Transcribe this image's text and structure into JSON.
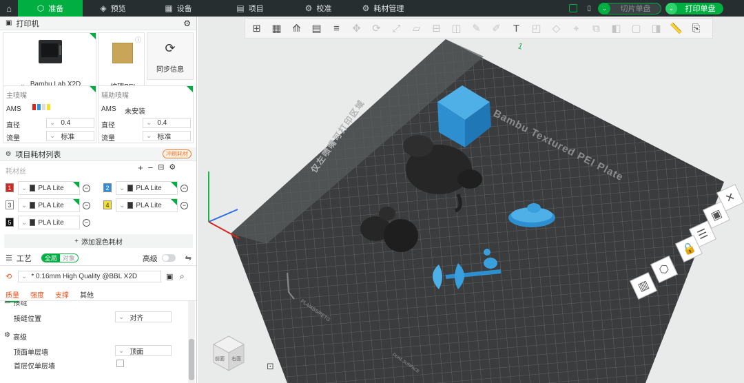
{
  "topbar": {
    "tabs": [
      {
        "label": "准备",
        "icon": "prepare-icon",
        "active": true
      },
      {
        "label": "预览",
        "icon": "preview-icon"
      },
      {
        "label": "设备",
        "icon": "device-icon"
      },
      {
        "label": "项目",
        "icon": "project-icon"
      },
      {
        "label": "校准",
        "icon": "calibrate-icon"
      },
      {
        "label": "耗材管理",
        "icon": "filament-manage-icon"
      }
    ],
    "slice_label": "切片单盘",
    "print_label": "打印单盘",
    "accent": "#00ae42"
  },
  "printer": {
    "section_title": "打印机",
    "model": "Bambu Lab X2D",
    "plate": "纹理PEI...",
    "sync_label": "同步信息",
    "main_nozzle": {
      "title": "主喷嘴",
      "ams": "AMS",
      "diameter_label": "直径",
      "diameter": "0.4",
      "flow_label": "流量",
      "flow": "标准"
    },
    "aux_nozzle": {
      "title": "辅助喷嘴",
      "ams": "AMS",
      "ams_state": "未安装",
      "diameter_label": "直径",
      "diameter": "0.4",
      "flow_label": "流量",
      "flow": "标准"
    }
  },
  "filament": {
    "section_title": "项目耗材列表",
    "badge": "冲刷耗材",
    "list_label": "耗材丝",
    "slots": [
      {
        "num": "1",
        "name": "PLA Lite",
        "color": "#d9251d",
        "text_color": "#ffffff"
      },
      {
        "num": "2",
        "name": "PLA Lite",
        "color": "#2f8fd8",
        "text_color": "#ffffff"
      },
      {
        "num": "3",
        "name": "PLA Lite",
        "color": "#ffffff",
        "text_color": "#333333"
      },
      {
        "num": "4",
        "name": "PLA Lite",
        "color": "#f5e02e",
        "text_color": "#333333"
      },
      {
        "num": "5",
        "name": "PLA Lite",
        "color": "#111111",
        "text_color": "#ffffff"
      }
    ],
    "add_mix_label": "添加混色耗材"
  },
  "process": {
    "section_title": "工艺",
    "toggle_global": "全局",
    "toggle_object": "对象",
    "advanced_label": "高级",
    "preset": "* 0.16mm High Quality @BBL X2D",
    "tabs": [
      "质量",
      "强度",
      "支撑",
      "其他"
    ],
    "group_partial": "接缝",
    "seam_label": "接缝位置",
    "seam_value": "对齐",
    "adv_group": "高级",
    "top_wall_label": "顶面单层墙",
    "top_wall_value": "顶面",
    "first_layer_label": "首层仅单层墙"
  },
  "viewport": {
    "plate_label": "Bambu Textured PEI Plate",
    "nozzle_area_label": "仅左喷嘴可打印区域",
    "plate_marking": "PLA/ABS/PETG",
    "plate_marking2": "DUAL SURFACE",
    "plate_number": "1",
    "cube_front": "前面",
    "cube_right": "右面"
  }
}
